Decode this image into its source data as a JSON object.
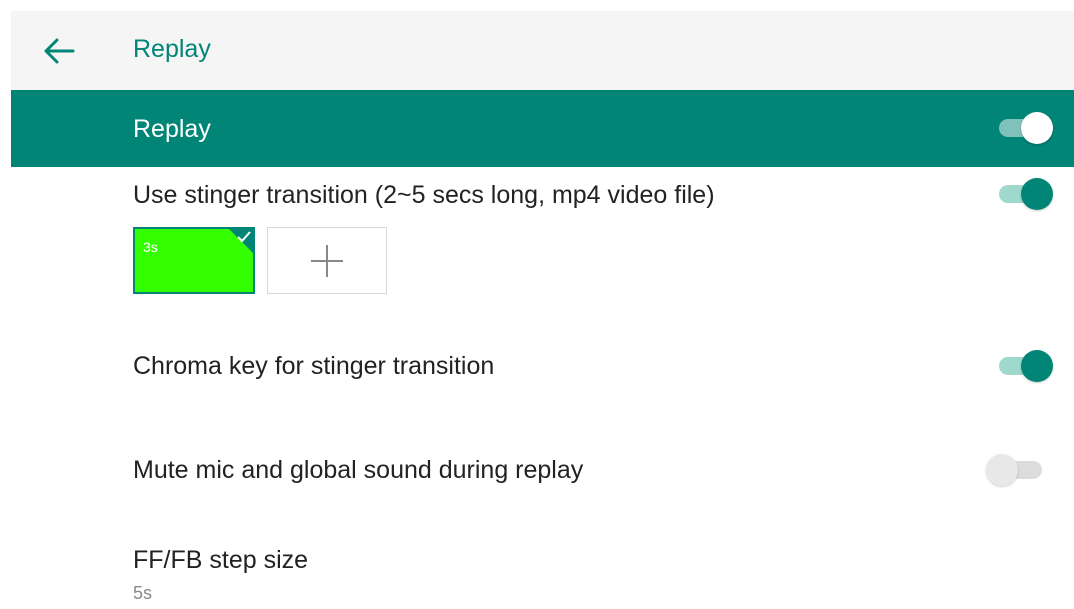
{
  "appbar": {
    "title": "Replay",
    "back_icon": "arrow-left-icon"
  },
  "section": {
    "title": "Replay",
    "enabled": true
  },
  "settings": {
    "stinger": {
      "label": "Use stinger transition (2~5 secs long, mp4 video file)",
      "enabled": true
    },
    "stinger_clip": {
      "duration": "3s",
      "color": "#33ff00",
      "selected": true
    },
    "add_clip": {
      "icon": "plus-icon"
    },
    "chroma": {
      "label": "Chroma key for stinger transition",
      "enabled": true
    },
    "mute": {
      "label": "Mute mic and global sound during replay",
      "enabled": false
    },
    "step": {
      "label": "FF/FB step size",
      "value": "5s"
    }
  },
  "colors": {
    "accent": "#008577",
    "accent_track": "#9fd9cc"
  }
}
